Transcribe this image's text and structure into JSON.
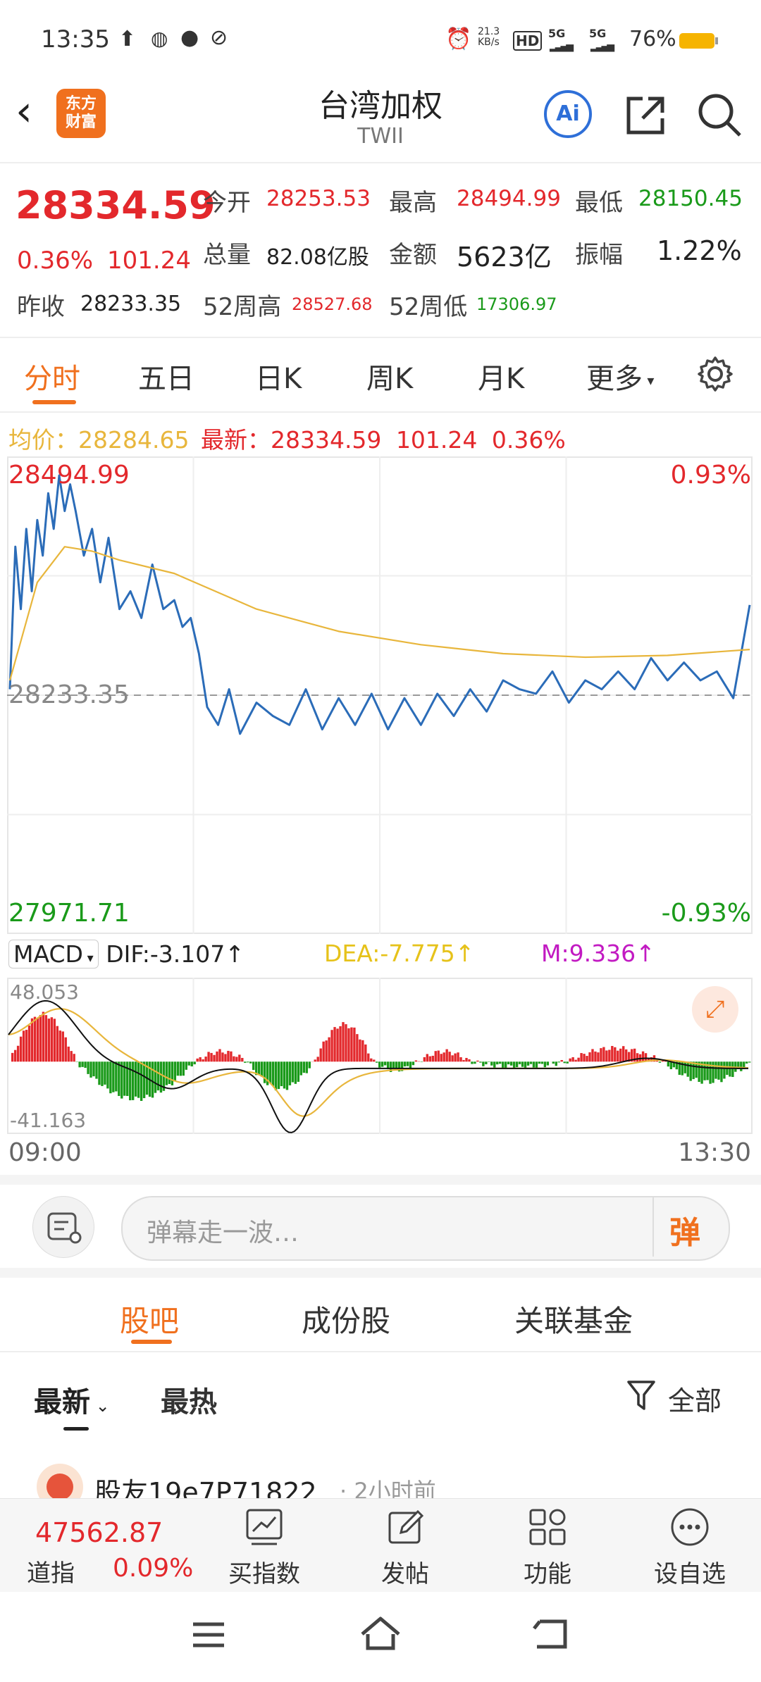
{
  "status_bar": {
    "time": "13:35",
    "net_speed_top": "21.3",
    "net_speed_unit": "KB/s",
    "hd": "HD",
    "sig1": "5G",
    "sig2": "5G",
    "battery": "76%"
  },
  "header": {
    "logo_line1": "东方",
    "logo_line2": "财富",
    "title": "台湾加权",
    "subtitle": "TWII",
    "ai_label": "Ai"
  },
  "quote": {
    "price": "28334.59",
    "change_pct": "0.36%",
    "change": "101.24",
    "open_label": "今开",
    "open": "28253.53",
    "high_label": "最高",
    "high": "28494.99",
    "low_label": "最低",
    "low": "28150.45",
    "volume_label": "总量",
    "volume": "82.08亿股",
    "amount_label": "金额",
    "amount": "5623亿",
    "amplitude_label": "振幅",
    "amplitude": "1.22%",
    "prev_close_label": "昨收",
    "prev_close": "28233.35",
    "w52_high_label": "52周高",
    "w52_high": "28527.68",
    "w52_low_label": "52周低",
    "w52_low": "17306.97"
  },
  "tabs": {
    "items": [
      "分时",
      "五日",
      "日K",
      "周K",
      "月K",
      "更多"
    ],
    "active": "分时"
  },
  "chart_info": {
    "avg_label": "均价：",
    "avg": "28284.65",
    "latest_label": "最新：",
    "latest": "28334.59",
    "change": "101.24",
    "change_pct": "0.36%"
  },
  "chart_data": {
    "type": "line",
    "title": "",
    "xlabel": "",
    "ylabel": "",
    "x_range": [
      "09:00",
      "13:30"
    ],
    "ylim": [
      27971.71,
      28494.99
    ],
    "y_top_label": "28494.99",
    "y_bottom_label": "27971.71",
    "pct_top_label": "0.93%",
    "pct_bottom_label": "-0.93%",
    "reference_line": 28233.35,
    "reference_label": "28233.35",
    "series": [
      {
        "name": "price",
        "color": "#2b6cb8",
        "x": [
          0,
          2,
          4,
          6,
          8,
          10,
          12,
          14,
          16,
          18,
          20,
          22,
          24,
          27,
          30,
          33,
          36,
          40,
          44,
          48,
          52,
          56,
          60,
          63,
          66,
          69,
          72,
          76,
          80,
          84,
          90,
          96,
          102,
          108,
          114,
          120,
          126,
          132,
          138,
          144,
          150,
          156,
          162,
          168,
          174,
          180,
          186,
          192,
          198,
          204,
          210,
          216,
          222,
          228,
          234,
          240,
          246,
          252,
          258,
          264,
          270
        ],
        "y": [
          28240,
          28400,
          28330,
          28420,
          28350,
          28430,
          28390,
          28460,
          28420,
          28480,
          28440,
          28470,
          28440,
          28390,
          28420,
          28360,
          28410,
          28330,
          28350,
          28320,
          28380,
          28330,
          28340,
          28310,
          28320,
          28280,
          28220,
          28200,
          28240,
          28190,
          28225,
          28210,
          28200,
          28240,
          28195,
          28230,
          28200,
          28235,
          28195,
          28230,
          28200,
          28235,
          28210,
          28240,
          28215,
          28250,
          28240,
          28235,
          28260,
          28225,
          28250,
          28240,
          28260,
          28240,
          28275,
          28250,
          28270,
          28250,
          28260,
          28230,
          28334.59
        ]
      },
      {
        "name": "avg",
        "color": "#e8b63c",
        "x": [
          0,
          10,
          20,
          30,
          40,
          60,
          90,
          120,
          150,
          180,
          210,
          240,
          270
        ],
        "y": [
          28250,
          28360,
          28400,
          28395,
          28385,
          28370,
          28330,
          28305,
          28290,
          28280,
          28276,
          28278,
          28284.65
        ]
      }
    ]
  },
  "macd": {
    "label": "MACD",
    "dif_label": "DIF:",
    "dif": "-3.107",
    "dea_label": "DEA:",
    "dea": "-7.775",
    "m_label": "M:",
    "m": "9.336",
    "arrow": "↑",
    "y_top_label": "48.053",
    "y_bottom_label": "-41.163",
    "ylim": [
      -41.163,
      48.053
    ]
  },
  "x_axis": {
    "start": "09:00",
    "end": "13:30"
  },
  "comment": {
    "placeholder": "弹幕走一波…",
    "danmu_label": "弹"
  },
  "sub_tabs": {
    "items": [
      "股吧",
      "成份股",
      "关联基金"
    ],
    "active": "股吧"
  },
  "feed": {
    "sort_latest": "最新",
    "sort_hot": "最热",
    "filter_label": "全部",
    "first_post_user": "股友19e7P71822",
    "first_post_time": "2小时前"
  },
  "bottom_bar": {
    "index_value": "47562.87",
    "index_name": "道指",
    "index_change": "0.09%",
    "items": [
      "买指数",
      "发帖",
      "功能",
      "设自选"
    ]
  },
  "colors": {
    "up": "#e3282c",
    "down": "#1a9a1a",
    "accent": "#f0701e",
    "price_line": "#2b6cb8",
    "avg_line": "#e8b63c",
    "dea_color": "#e6c21a",
    "m_color": "#c21ac2"
  }
}
